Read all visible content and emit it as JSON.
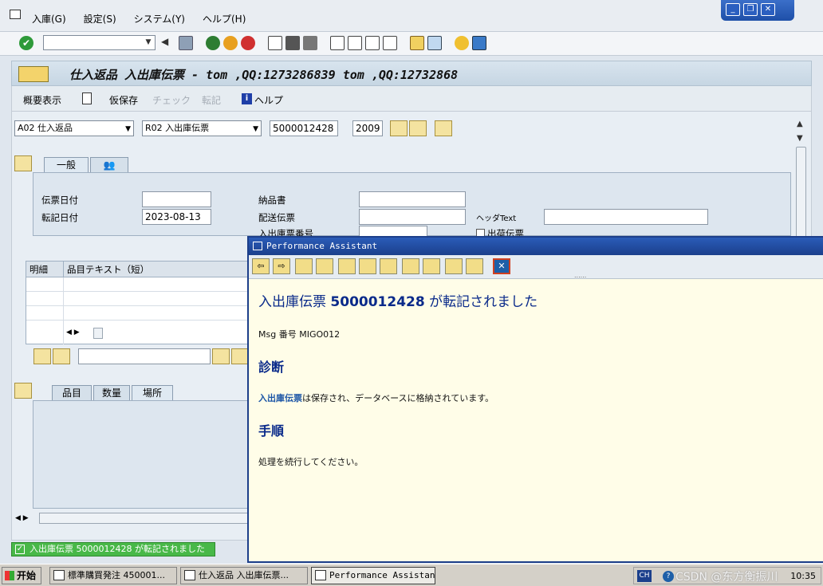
{
  "menu": [
    "入庫(G)",
    "設定(S)",
    "システム(Y)",
    "ヘルプ(H)"
  ],
  "colors": {
    "accent": "#1d3f8a",
    "status_ok": "#48b848",
    "pa_background": "#fffde8"
  },
  "title": "仕入返品 入出庫伝票 - tom ,QQ:1273286839 tom ,QQ:12732868",
  "app_toolbar": {
    "summary": "概要表示",
    "hold": "仮保存",
    "check": "チェック",
    "post": "転記",
    "help": "ヘルプ"
  },
  "header": {
    "transaction": "A02 仕入返品",
    "reference": "R02 入出庫伝票",
    "doc_number": "5000012428",
    "year": "2009"
  },
  "tabs": {
    "general": "一般"
  },
  "general": {
    "doc_date_label": "伝票日付",
    "doc_date": "",
    "post_date_label": "転記日付",
    "post_date": "2023-08-13",
    "delivery_note_label": "納品書",
    "shipping_doc_label": "配送伝票",
    "header_text_label": "ヘッダText",
    "gr_number_label": "入出庫票番号",
    "outbound_label": "出荷伝票"
  },
  "items_grid": {
    "columns": [
      "明細",
      "品目テキスト（短）"
    ]
  },
  "detail_tabs": [
    "品目",
    "数量",
    "場所"
  ],
  "status": {
    "message": "入出庫伝票 5000012428 が転記されました"
  },
  "pa": {
    "window_title": "Performance Assistant",
    "heading_prefix": "入出庫伝票",
    "heading_number": "5000012428",
    "heading_suffix": "が転記されました",
    "msg_no_label": "Msg 番号",
    "msg_no": "MIGO012",
    "diagnosis_title": "診断",
    "diagnosis_link": "入出庫伝票",
    "diagnosis_text": "は保存され、データベースに格納されています。",
    "procedure_title": "手順",
    "procedure_text": "処理を続行してください。"
  },
  "taskbar": {
    "start": "开始",
    "tasks": [
      "標準購買発注 450001...",
      "仕入返品 入出庫伝票...",
      "Performance Assistant"
    ],
    "ime": "CH",
    "watermark": "CSDN @东方衡振川",
    "clock": "10:35"
  }
}
